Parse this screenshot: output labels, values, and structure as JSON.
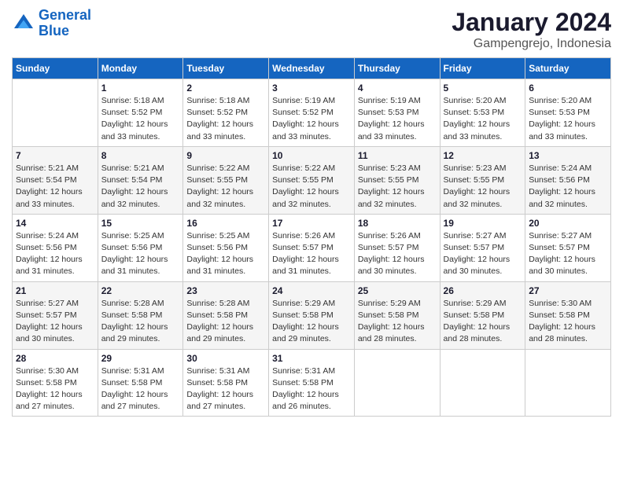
{
  "logo": {
    "line1": "General",
    "line2": "Blue"
  },
  "title": "January 2024",
  "subtitle": "Gampengrejo, Indonesia",
  "days_header": [
    "Sunday",
    "Monday",
    "Tuesday",
    "Wednesday",
    "Thursday",
    "Friday",
    "Saturday"
  ],
  "weeks": [
    [
      {
        "num": "",
        "info": ""
      },
      {
        "num": "1",
        "info": "Sunrise: 5:18 AM\nSunset: 5:52 PM\nDaylight: 12 hours\nand 33 minutes."
      },
      {
        "num": "2",
        "info": "Sunrise: 5:18 AM\nSunset: 5:52 PM\nDaylight: 12 hours\nand 33 minutes."
      },
      {
        "num": "3",
        "info": "Sunrise: 5:19 AM\nSunset: 5:52 PM\nDaylight: 12 hours\nand 33 minutes."
      },
      {
        "num": "4",
        "info": "Sunrise: 5:19 AM\nSunset: 5:53 PM\nDaylight: 12 hours\nand 33 minutes."
      },
      {
        "num": "5",
        "info": "Sunrise: 5:20 AM\nSunset: 5:53 PM\nDaylight: 12 hours\nand 33 minutes."
      },
      {
        "num": "6",
        "info": "Sunrise: 5:20 AM\nSunset: 5:53 PM\nDaylight: 12 hours\nand 33 minutes."
      }
    ],
    [
      {
        "num": "7",
        "info": "Sunrise: 5:21 AM\nSunset: 5:54 PM\nDaylight: 12 hours\nand 33 minutes."
      },
      {
        "num": "8",
        "info": "Sunrise: 5:21 AM\nSunset: 5:54 PM\nDaylight: 12 hours\nand 32 minutes."
      },
      {
        "num": "9",
        "info": "Sunrise: 5:22 AM\nSunset: 5:55 PM\nDaylight: 12 hours\nand 32 minutes."
      },
      {
        "num": "10",
        "info": "Sunrise: 5:22 AM\nSunset: 5:55 PM\nDaylight: 12 hours\nand 32 minutes."
      },
      {
        "num": "11",
        "info": "Sunrise: 5:23 AM\nSunset: 5:55 PM\nDaylight: 12 hours\nand 32 minutes."
      },
      {
        "num": "12",
        "info": "Sunrise: 5:23 AM\nSunset: 5:55 PM\nDaylight: 12 hours\nand 32 minutes."
      },
      {
        "num": "13",
        "info": "Sunrise: 5:24 AM\nSunset: 5:56 PM\nDaylight: 12 hours\nand 32 minutes."
      }
    ],
    [
      {
        "num": "14",
        "info": "Sunrise: 5:24 AM\nSunset: 5:56 PM\nDaylight: 12 hours\nand 31 minutes."
      },
      {
        "num": "15",
        "info": "Sunrise: 5:25 AM\nSunset: 5:56 PM\nDaylight: 12 hours\nand 31 minutes."
      },
      {
        "num": "16",
        "info": "Sunrise: 5:25 AM\nSunset: 5:56 PM\nDaylight: 12 hours\nand 31 minutes."
      },
      {
        "num": "17",
        "info": "Sunrise: 5:26 AM\nSunset: 5:57 PM\nDaylight: 12 hours\nand 31 minutes."
      },
      {
        "num": "18",
        "info": "Sunrise: 5:26 AM\nSunset: 5:57 PM\nDaylight: 12 hours\nand 30 minutes."
      },
      {
        "num": "19",
        "info": "Sunrise: 5:27 AM\nSunset: 5:57 PM\nDaylight: 12 hours\nand 30 minutes."
      },
      {
        "num": "20",
        "info": "Sunrise: 5:27 AM\nSunset: 5:57 PM\nDaylight: 12 hours\nand 30 minutes."
      }
    ],
    [
      {
        "num": "21",
        "info": "Sunrise: 5:27 AM\nSunset: 5:57 PM\nDaylight: 12 hours\nand 30 minutes."
      },
      {
        "num": "22",
        "info": "Sunrise: 5:28 AM\nSunset: 5:58 PM\nDaylight: 12 hours\nand 29 minutes."
      },
      {
        "num": "23",
        "info": "Sunrise: 5:28 AM\nSunset: 5:58 PM\nDaylight: 12 hours\nand 29 minutes."
      },
      {
        "num": "24",
        "info": "Sunrise: 5:29 AM\nSunset: 5:58 PM\nDaylight: 12 hours\nand 29 minutes."
      },
      {
        "num": "25",
        "info": "Sunrise: 5:29 AM\nSunset: 5:58 PM\nDaylight: 12 hours\nand 28 minutes."
      },
      {
        "num": "26",
        "info": "Sunrise: 5:29 AM\nSunset: 5:58 PM\nDaylight: 12 hours\nand 28 minutes."
      },
      {
        "num": "27",
        "info": "Sunrise: 5:30 AM\nSunset: 5:58 PM\nDaylight: 12 hours\nand 28 minutes."
      }
    ],
    [
      {
        "num": "28",
        "info": "Sunrise: 5:30 AM\nSunset: 5:58 PM\nDaylight: 12 hours\nand 27 minutes."
      },
      {
        "num": "29",
        "info": "Sunrise: 5:31 AM\nSunset: 5:58 PM\nDaylight: 12 hours\nand 27 minutes."
      },
      {
        "num": "30",
        "info": "Sunrise: 5:31 AM\nSunset: 5:58 PM\nDaylight: 12 hours\nand 27 minutes."
      },
      {
        "num": "31",
        "info": "Sunrise: 5:31 AM\nSunset: 5:58 PM\nDaylight: 12 hours\nand 26 minutes."
      },
      {
        "num": "",
        "info": ""
      },
      {
        "num": "",
        "info": ""
      },
      {
        "num": "",
        "info": ""
      }
    ]
  ]
}
